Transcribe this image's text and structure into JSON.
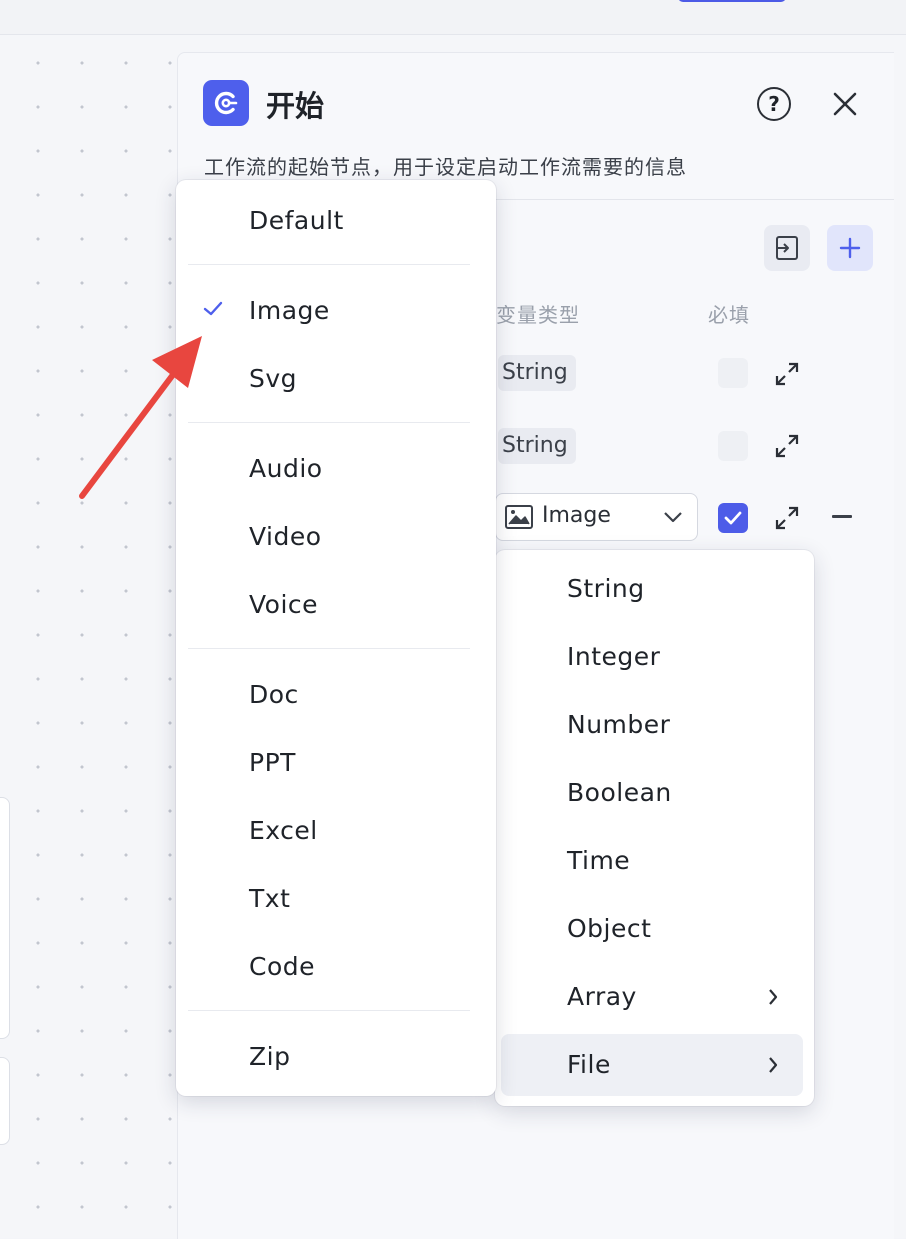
{
  "panel": {
    "title": "开始",
    "description": "工作流的起始节点，用于设定启动工作流需要的信息",
    "help_icon": "question-circle-icon",
    "close_icon": "close-icon"
  },
  "actions": {
    "import_icon": "import-icon",
    "add_icon": "plus-icon"
  },
  "table": {
    "col_type": "变量类型",
    "col_required": "必填",
    "rows": [
      {
        "type": "String",
        "required": false
      },
      {
        "type": "String",
        "required": false
      },
      {
        "type": "Image",
        "required": true
      }
    ]
  },
  "file_menu": {
    "selected": "Image",
    "groups": [
      [
        "Default"
      ],
      [
        "Image",
        "Svg"
      ],
      [
        "Audio",
        "Video",
        "Voice"
      ],
      [
        "Doc",
        "PPT",
        "Excel",
        "Txt",
        "Code"
      ],
      [
        "Zip"
      ]
    ]
  },
  "type_menu": {
    "items": [
      {
        "label": "String"
      },
      {
        "label": "Integer"
      },
      {
        "label": "Number"
      },
      {
        "label": "Boolean"
      },
      {
        "label": "Time"
      },
      {
        "label": "Object"
      },
      {
        "label": "Array",
        "submenu": true
      },
      {
        "label": "File",
        "submenu": true,
        "highlighted": true
      }
    ]
  },
  "colors": {
    "accent": "#4e5fec",
    "annotation_arrow": "#e8463f"
  }
}
